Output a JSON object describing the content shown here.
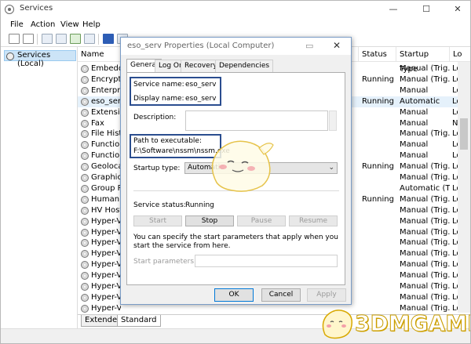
{
  "window": {
    "title": "Services",
    "min": "—",
    "max": "☐",
    "close": "✕"
  },
  "menu": [
    "File",
    "Action",
    "View",
    "Help"
  ],
  "tree": {
    "root": "Services (Local)"
  },
  "columns": {
    "name": "Name",
    "status": "Status",
    "startup": "Startup Type",
    "logon": "Lo"
  },
  "rows": [
    {
      "name": "Embedde",
      "status": "",
      "startup": "Manual (Trig...",
      "logon": "Lo"
    },
    {
      "name": "Encryptin",
      "status": "Running",
      "startup": "Manual (Trig...",
      "logon": "Lo"
    },
    {
      "name": "Enterprise",
      "status": "",
      "startup": "Manual",
      "logon": "Lo"
    },
    {
      "name": "eso_serv",
      "status": "Running",
      "startup": "Automatic",
      "logon": "Lo"
    },
    {
      "name": "Extensible",
      "status": "",
      "startup": "Manual",
      "logon": "Lo"
    },
    {
      "name": "Fax",
      "status": "",
      "startup": "Manual",
      "logon": "N"
    },
    {
      "name": "File Histor",
      "status": "",
      "startup": "Manual (Trig...",
      "logon": "Lo"
    },
    {
      "name": "Function",
      "status": "",
      "startup": "Manual",
      "logon": "Lo"
    },
    {
      "name": "Function",
      "status": "",
      "startup": "Manual",
      "logon": "Lo"
    },
    {
      "name": "Geolocatio",
      "status": "Running",
      "startup": "Manual (Trig...",
      "logon": "Lo"
    },
    {
      "name": "GraphicsP",
      "status": "",
      "startup": "Manual (Trig...",
      "logon": "Lo"
    },
    {
      "name": "Group Po",
      "status": "",
      "startup": "Automatic (T...",
      "logon": "Lo"
    },
    {
      "name": "Human In",
      "status": "Running",
      "startup": "Manual (Trig...",
      "logon": "Lo"
    },
    {
      "name": "HV Host S",
      "status": "",
      "startup": "Manual (Trig...",
      "logon": "Lo"
    },
    {
      "name": "Hyper-V D",
      "status": "",
      "startup": "Manual (Trig...",
      "logon": "Lo"
    },
    {
      "name": "Hyper-V G",
      "status": "",
      "startup": "Manual (Trig...",
      "logon": "Lo"
    },
    {
      "name": "Hyper-V C",
      "status": "",
      "startup": "Manual (Trig...",
      "logon": "Lo"
    },
    {
      "name": "Hyper-V G",
      "status": "",
      "startup": "Manual (Trig...",
      "logon": "Lo"
    },
    {
      "name": "Hyper-V H",
      "status": "",
      "startup": "Manual (Trig...",
      "logon": "Lo"
    },
    {
      "name": "Hyper-V P",
      "status": "",
      "startup": "Manual (Trig...",
      "logon": "Lo"
    },
    {
      "name": "Hyper-V R",
      "status": "",
      "startup": "Manual (Trig...",
      "logon": "Lo"
    },
    {
      "name": "Hyper-V T",
      "status": "",
      "startup": "Manual (Trig...",
      "logon": "Lo"
    },
    {
      "name": "Hyper-V V",
      "status": "",
      "startup": "Manual (Trig...",
      "logon": "Lo"
    }
  ],
  "bottom_tabs": [
    "Extended",
    "Standard"
  ],
  "dialog": {
    "title": "eso_serv Properties (Local Computer)",
    "min": "▭",
    "close": "✕",
    "tabs": [
      "General",
      "Log On",
      "Recovery",
      "Dependencies"
    ],
    "service_name_label": "Service name:",
    "service_name_value": "eso_serv",
    "display_name_label": "Display name:",
    "display_name_value": "eso_serv",
    "description_label": "Description:",
    "path_label": "Path to executable:",
    "path_value": "F:\\Software\\nssm\\nssm.exe",
    "startup_type_label": "Startup type:",
    "startup_type_value": "Automatic",
    "status_label": "Service status:",
    "status_value": "Running",
    "buttons": {
      "start": "Start",
      "stop": "Stop",
      "pause": "Pause",
      "resume": "Resume"
    },
    "hint": "You can specify the start parameters that apply when you start the service from here.",
    "start_params_label": "Start parameters:",
    "ok": "OK",
    "cancel": "Cancel",
    "apply": "Apply"
  },
  "watermark": "3DMGAME",
  "colors": {
    "highlight_box": "#2a4d8f",
    "selection": "#cce4f7",
    "watermark": "#d8a800"
  }
}
